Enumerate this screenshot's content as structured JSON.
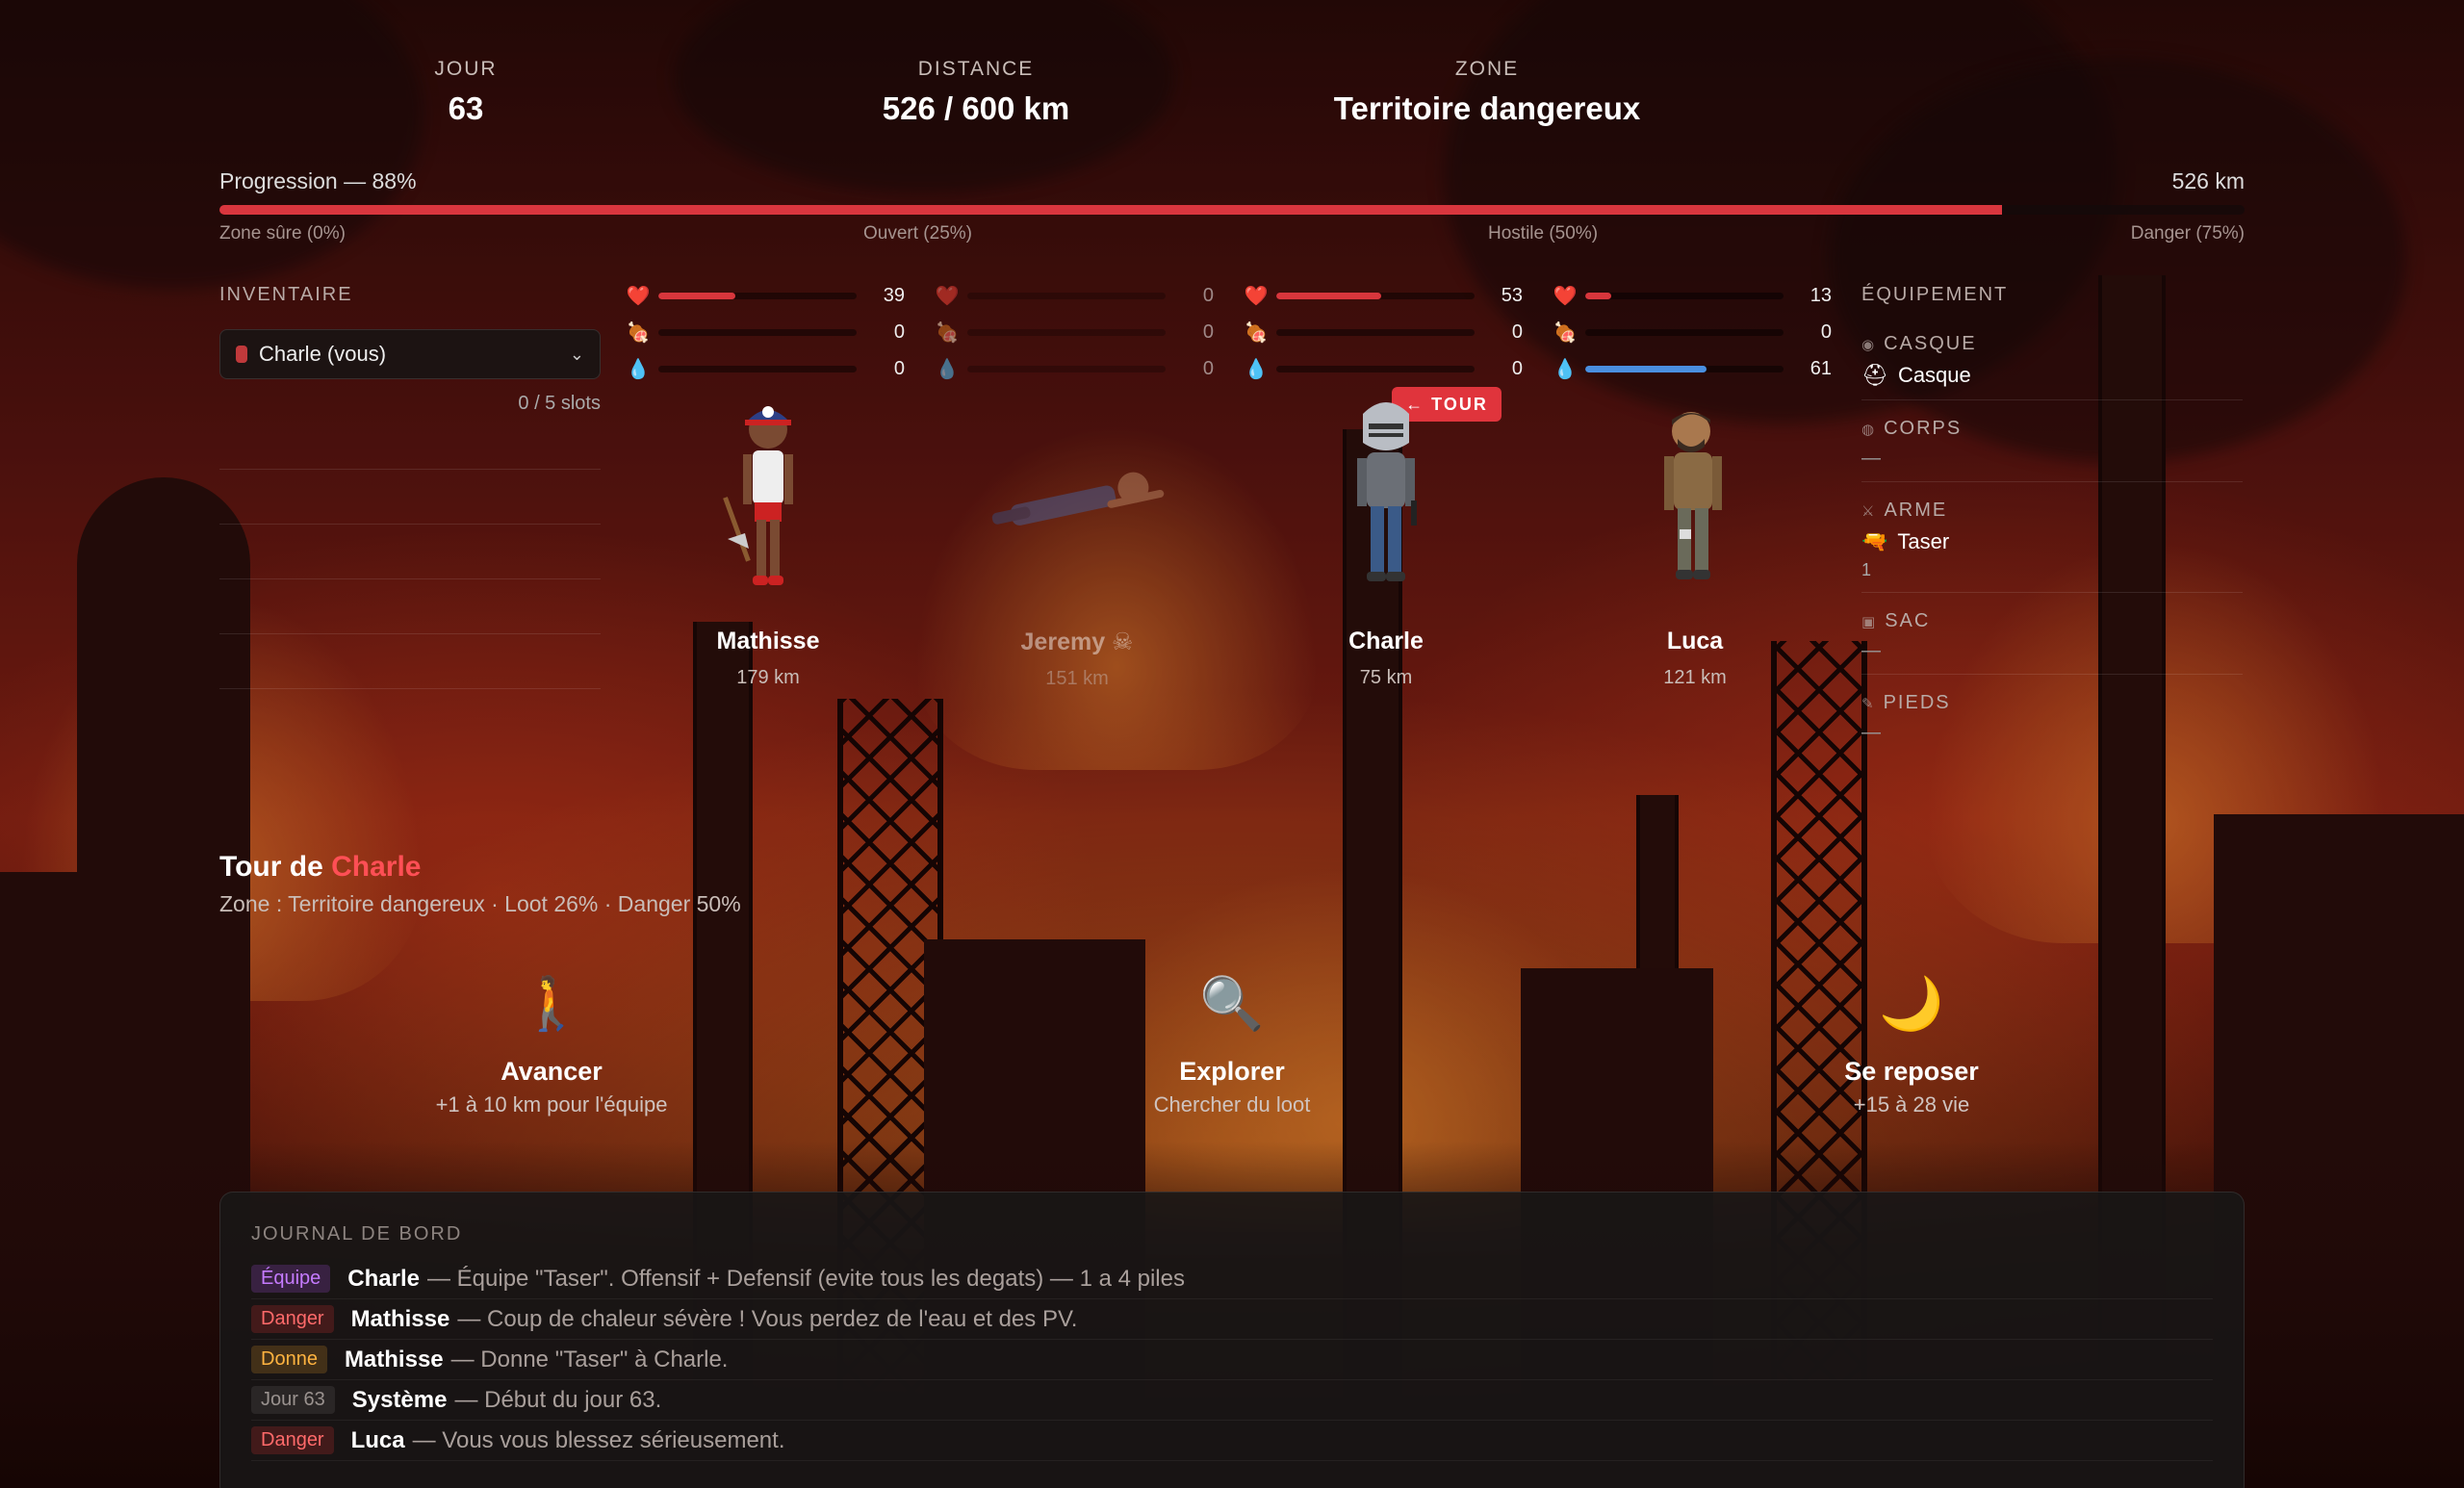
{
  "header": {
    "day_label": "JOUR",
    "day_value": "63",
    "distance_label": "DISTANCE",
    "distance_value": "526 / 600 km",
    "zone_label": "ZONE",
    "zone_value": "Territoire dangereux"
  },
  "progress": {
    "title": "Progression — 88%",
    "km": "526 km",
    "percent": 88,
    "marks": [
      "Zone sûre (0%)",
      "Ouvert (25%)",
      "Hostile (50%)",
      "Danger (75%)"
    ]
  },
  "inventory": {
    "label": "INVENTAIRE",
    "selected": "Charle (vous)",
    "slots": "0 / 5 slots"
  },
  "characters": [
    {
      "name": "Mathisse",
      "km": "179 km",
      "hp": 39,
      "food": 0,
      "water": 0,
      "dead": false
    },
    {
      "name": "Jeremy ☠",
      "km": "151 km",
      "hp": 0,
      "food": 0,
      "water": 0,
      "dead": true
    },
    {
      "name": "Charle",
      "km": "75 km",
      "hp": 53,
      "food": 0,
      "water": 0,
      "dead": false,
      "active": true
    },
    {
      "name": "Luca",
      "km": "121 km",
      "hp": 13,
      "food": 0,
      "water": 61,
      "dead": false
    }
  ],
  "turn_badge": "← TOUR",
  "equipment": {
    "label": "ÉQUIPEMENT",
    "slots": [
      {
        "label": "CASQUE",
        "icon": "helmet-icon",
        "item": "Casque"
      },
      {
        "label": "CORPS",
        "icon": "armor-icon",
        "empty": "—"
      },
      {
        "label": "ARME",
        "icon": "swords-icon",
        "item": "Taser",
        "sub": "1"
      },
      {
        "label": "SAC",
        "icon": "bag-icon",
        "empty": "—"
      },
      {
        "label": "PIEDS",
        "icon": "boots-icon",
        "empty": "—"
      }
    ]
  },
  "turn": {
    "prefix": "Tour de ",
    "player": "Charle",
    "info": "Zone : Territoire dangereux · Loot 26% · Danger 50%"
  },
  "actions": [
    {
      "icon": "walking-icon",
      "glyph": "🚶",
      "label": "Avancer",
      "desc": "+1 à 10 km pour l'équipe"
    },
    {
      "icon": "magnifier-icon",
      "glyph": "🔍",
      "label": "Explorer",
      "desc": "Chercher du loot"
    },
    {
      "icon": "moon-icon",
      "glyph": "🌙",
      "label": "Se reposer",
      "desc": "+15 à 28 vie"
    }
  ],
  "journal": {
    "label": "JOURNAL DE BORD",
    "entries": [
      {
        "tag": "Équipe",
        "type": "equipe",
        "who": "Charle",
        "msg": "— Équipe \"Taser\". Offensif + Defensif (evite tous les degats) — 1 a 4 piles"
      },
      {
        "tag": "Danger",
        "type": "danger",
        "who": "Mathisse",
        "msg": "— Coup de chaleur sévère ! Vous perdez de l'eau et des PV."
      },
      {
        "tag": "Donne",
        "type": "donne",
        "who": "Mathisse",
        "msg": "— Donne \"Taser\" à Charle."
      },
      {
        "tag": "Jour 63",
        "type": "jour",
        "who": "Système",
        "msg": "— Début du jour 63."
      },
      {
        "tag": "Danger",
        "type": "danger",
        "who": "Luca",
        "msg": "— Vous vous blessez sérieusement."
      }
    ]
  },
  "colors": {
    "accent": "#e0343c",
    "hp": "#d8363c",
    "water": "#4a8fe0"
  }
}
